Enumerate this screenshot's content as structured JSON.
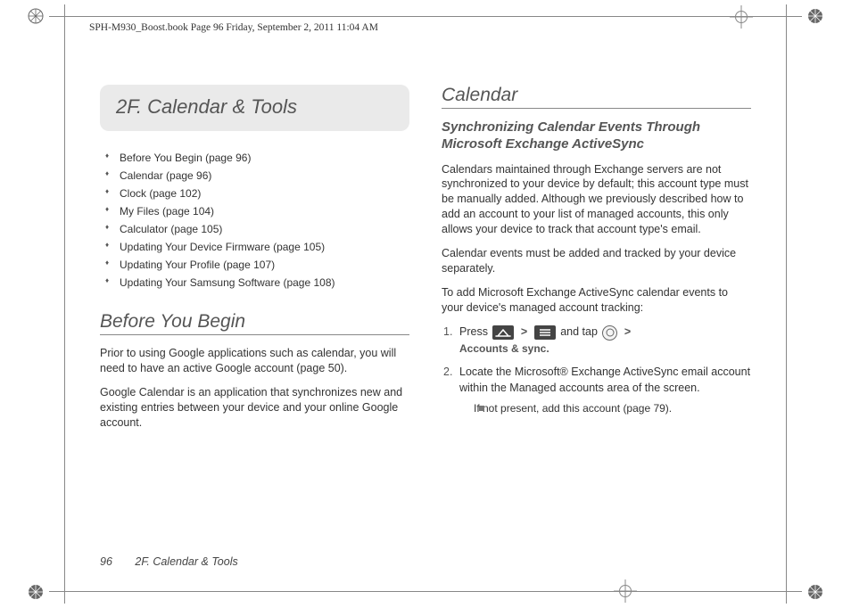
{
  "header_info": "SPH-M930_Boost.book  Page 96  Friday, September 2, 2011  11:04 AM",
  "chapter": {
    "label": "2F.   Calendar & Tools"
  },
  "toc": [
    "Before You Begin (page 96)",
    "Calendar (page 96)",
    "Clock (page 102)",
    "My Files (page 104)",
    "Calculator (page 105)",
    "Updating Your Device Firmware (page 105)",
    "Updating Your Profile (page 107)",
    "Updating Your Samsung Software (page 108)"
  ],
  "left": {
    "h_before": "Before You Begin",
    "p1": "Prior to using Google applications such as calendar, you will need to have an active Google account (page 50).",
    "p2": "Google Calendar is an application that synchronizes new and existing entries between your device and your online Google account."
  },
  "right": {
    "h_cal": "Calendar",
    "h_sync": "Synchronizing Calendar Events Through Microsoft Exchange ActiveSync",
    "p1": "Calendars maintained through Exchange servers are not synchronized to your device by default; this account type must be manually added. Although we previously described how to add an account to your list of managed accounts, this only allows your device to track that account type's email.",
    "p2": "Calendar events must be added and tracked by your device separately.",
    "p3": "To add Microsoft Exchange ActiveSync calendar events to your device's managed account tracking:",
    "step1_a": "Press ",
    "step1_b": " and tap ",
    "step1_c": "Accounts & sync.",
    "step2": "Locate the Microsoft® Exchange ActiveSync email account within the Managed accounts area of the screen.",
    "sub1": "If not present, add this account (page 79)."
  },
  "footer": {
    "page": "96",
    "title": "2F. Calendar & Tools"
  }
}
